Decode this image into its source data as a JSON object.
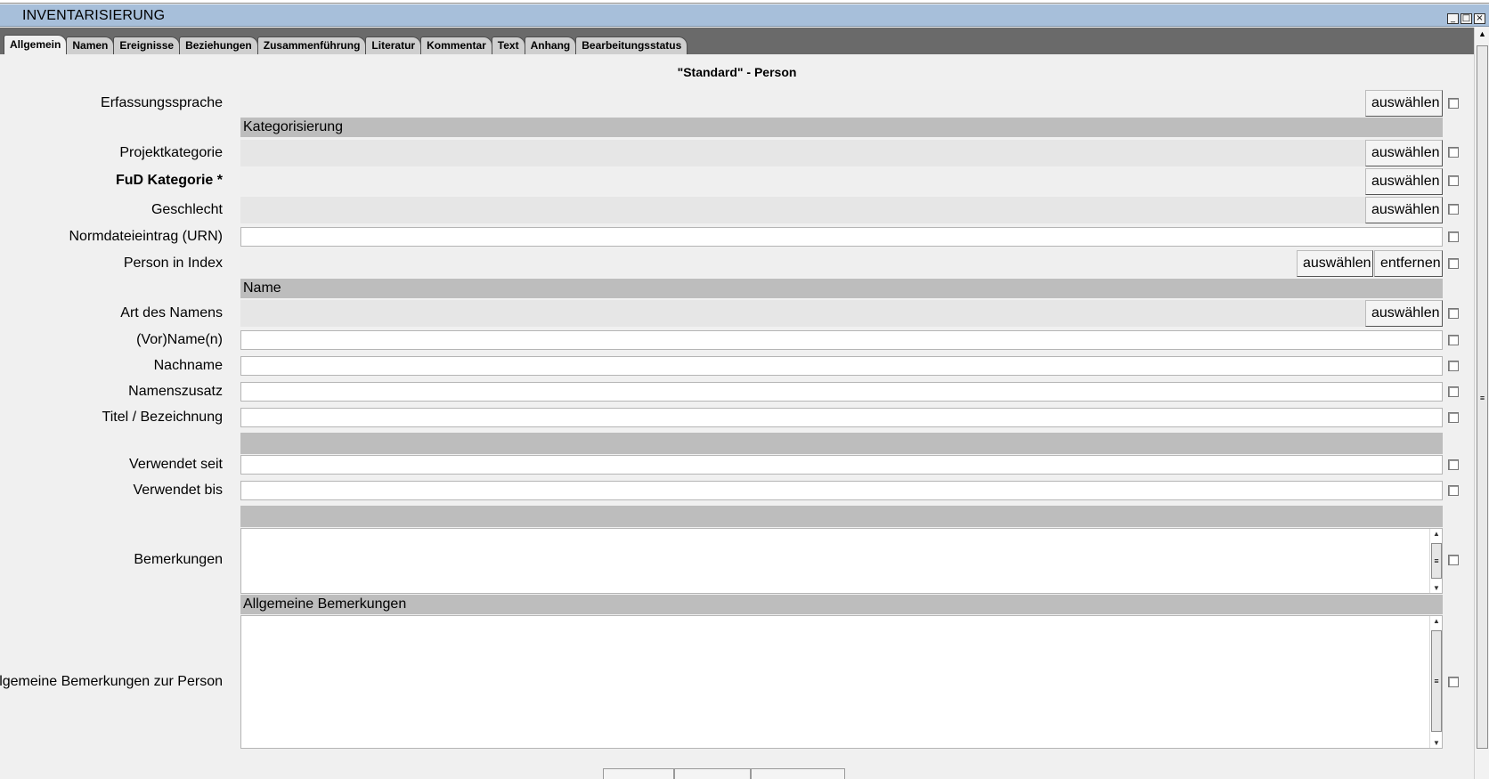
{
  "window": {
    "title": "INVENTARISIERUNG",
    "controls": [
      "minimize",
      "maximize",
      "close"
    ]
  },
  "tabs": [
    {
      "label": "Allgemein",
      "active": true
    },
    {
      "label": "Namen"
    },
    {
      "label": "Ereignisse"
    },
    {
      "label": "Beziehungen"
    },
    {
      "label": "Zusammenführung"
    },
    {
      "label": "Literatur"
    },
    {
      "label": "Kommentar"
    },
    {
      "label": "Text"
    },
    {
      "label": "Anhang"
    },
    {
      "label": "Bearbeitungsstatus"
    }
  ],
  "form": {
    "title": "\"Standard\" - Person",
    "buttons": {
      "select": "auswählen",
      "remove": "entfernen"
    },
    "fields": {
      "erfassungssprache": "Erfassungssprache",
      "section_kategorisierung": "Kategorisierung",
      "projektkategorie": "Projektkategorie",
      "fud_kategorie": "FuD Kategorie *",
      "geschlecht": "Geschlecht",
      "normdateieintrag": "Normdateieintrag (URN)",
      "person_in_index": "Person in Index",
      "section_name": "Name",
      "art_des_namens": "Art des Namens",
      "vorname": "(Vor)Name(n)",
      "nachname": "Nachname",
      "namenszusatz": "Namenszusatz",
      "titel": "Titel / Bezeichnung",
      "verwendet_seit": "Verwendet seit",
      "verwendet_bis": "Verwendet bis",
      "bemerkungen": "Bemerkungen",
      "section_allgemeine_bemerkungen": "Allgemeine Bemerkungen",
      "allgemeine_bemerkungen_person": "Allgemeine Bemerkungen zur Person"
    }
  },
  "icons": {
    "minimize": "minimize-icon",
    "maximize": "maximize-icon",
    "close": "close-icon",
    "scroll_grip": "scroll-grip-icon"
  },
  "colors": {
    "titlebar": "#a7bfda",
    "tabbar": "#6a6a6a",
    "section_header": "#bdbdbd",
    "select_row": "#e6e6e6"
  }
}
